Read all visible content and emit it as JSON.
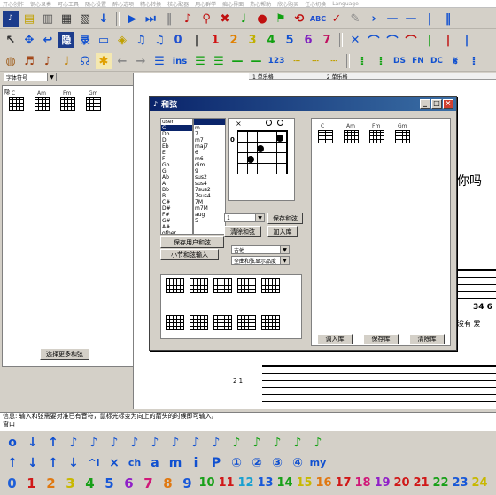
{
  "menu": [
    "开心创作",
    "钢心录奏",
    "可心工具",
    "随心设置",
    "醉心选项",
    "精心转换",
    "核心配器",
    "用心群学",
    "痴心界面",
    "热心帮助",
    "欣心购买",
    "任心切换",
    "Language"
  ],
  "toolbar1_icons": [
    "app-icon",
    "keyboard-icon",
    "print-icon",
    "play-icon",
    "stop-icon",
    "record-icon"
  ],
  "toolbar2": {
    "numbers": [
      "0",
      "1",
      "2",
      "3",
      "4",
      "5",
      "6",
      "7"
    ],
    "number_colors": [
      "#2050d0",
      "#d01010",
      "#e08000",
      "#c0b000",
      "#10a010",
      "#1050d0",
      "#8020c0",
      "#c01060"
    ],
    "labels": [
      "隐",
      "录"
    ]
  },
  "toolbar3": {
    "labels": [
      "ins",
      "123",
      "DS",
      "FN",
      "DC"
    ]
  },
  "left_panel": {
    "font_combo": "字体符号",
    "chords": [
      "C",
      "Am",
      "Fm",
      "Gm"
    ],
    "more_chords_button": "选择更多和弦"
  },
  "score": {
    "tabs": [
      "1 单乐格",
      "2 单乐格"
    ],
    "text_fragment": "你吗",
    "measure_label": "2 1",
    "right_fragments": [
      "34 6",
      "没有 爱"
    ]
  },
  "dialog": {
    "title": "和弦",
    "root_list": [
      "user",
      "C",
      "Db",
      "D",
      "Eb",
      "E",
      "F",
      "Gb",
      "G",
      "Ab",
      "A",
      "Bb",
      "B",
      "C#",
      "D#",
      "F#",
      "G#",
      "A#",
      "other"
    ],
    "root_selected": 1,
    "type_list": [
      "",
      "m",
      "7",
      "m7",
      "maj7",
      "6",
      "m6",
      "dim",
      "9",
      "sus2",
      "sus4",
      "7sus2",
      "7sus4",
      "7M",
      "m7M",
      "aug",
      "5"
    ],
    "type_selected": 0,
    "fret_number": "0",
    "fret_combo": "1",
    "save_chord": "保存和弦",
    "clear_chord": "清除和弦",
    "add_lib": "加入库",
    "save_user_chord": "保存用户和弦",
    "measure_chord_input": "小节和弦输入",
    "instrument_combo": "吉他",
    "display_combo": "全曲和弦显示品度",
    "library_chords": [
      "C",
      "Am",
      "Fm",
      "Gm"
    ],
    "import_lib": "调入库",
    "save_lib": "保存库",
    "clear_lib": "清除库"
  },
  "status": {
    "label": "信息",
    "text": "输入和弦需要对准已有音符，鼠标光标变为向上的箭头的时候即可输入。",
    "label2": "窗口"
  },
  "bottom_row1": [
    "o",
    "↓",
    "↑",
    "♪",
    "♪",
    "♪",
    "♪",
    "♪",
    "♪",
    "♪",
    "♪",
    "♪",
    "♪",
    "♪",
    "♪",
    "♪"
  ],
  "bottom_row2": [
    "↑",
    "↓",
    "↑",
    "↓",
    "^i",
    "×",
    "ch",
    "a",
    "m",
    "i",
    "P",
    "①",
    "②",
    "③",
    "④",
    "my"
  ],
  "bottom_numbers": [
    "0",
    "1",
    "2",
    "3",
    "4",
    "5",
    "6",
    "7",
    "8",
    "9",
    "10",
    "11",
    "12",
    "13",
    "14",
    "15",
    "16",
    "17",
    "18",
    "19",
    "20",
    "21",
    "22",
    "23",
    "24"
  ],
  "number_palette": [
    "#1e5fd8",
    "#d01818",
    "#e07810",
    "#c8b800",
    "#18a018",
    "#1858d8",
    "#9020c8",
    "#d01878",
    "#e07810",
    "#1858d8",
    "#18a018",
    "#d01818",
    "#18a0d0",
    "#1858d8",
    "#18a018",
    "#c8b800",
    "#e07810",
    "#d01818",
    "#d01878",
    "#9020c8",
    "#d01818",
    "#d01818",
    "#18a018",
    "#1858d8",
    "#c8b800"
  ]
}
